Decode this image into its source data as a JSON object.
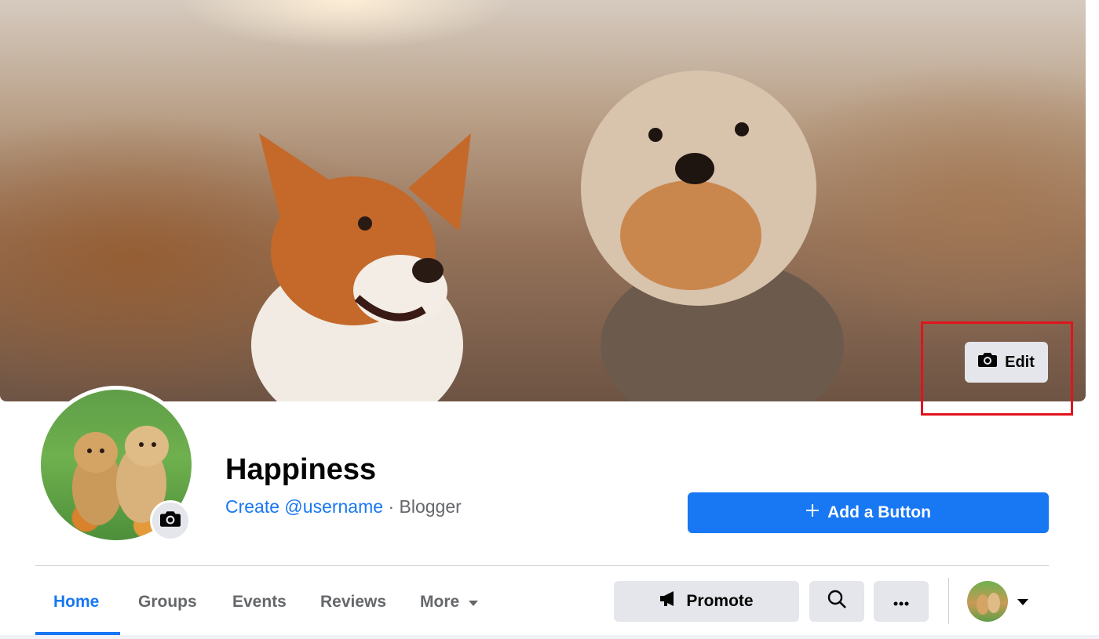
{
  "cover": {
    "edit_label": "Edit"
  },
  "profile": {
    "name": "Happiness",
    "username_link": "Create @username",
    "separator": " · ",
    "category": "Blogger"
  },
  "actions": {
    "add_button_label": "Add a Button"
  },
  "tabs": [
    {
      "label": "Home",
      "active": true
    },
    {
      "label": "Groups",
      "active": false
    },
    {
      "label": "Events",
      "active": false
    },
    {
      "label": "Reviews",
      "active": false
    },
    {
      "label": "More",
      "active": false
    }
  ],
  "toolbar": {
    "promote_label": "Promote",
    "search_icon": "search-icon",
    "more_icon": "ellipsis-icon"
  },
  "colors": {
    "accent": "#1877f2",
    "button_gray": "#e4e6eb",
    "highlight": "#e0141e"
  }
}
